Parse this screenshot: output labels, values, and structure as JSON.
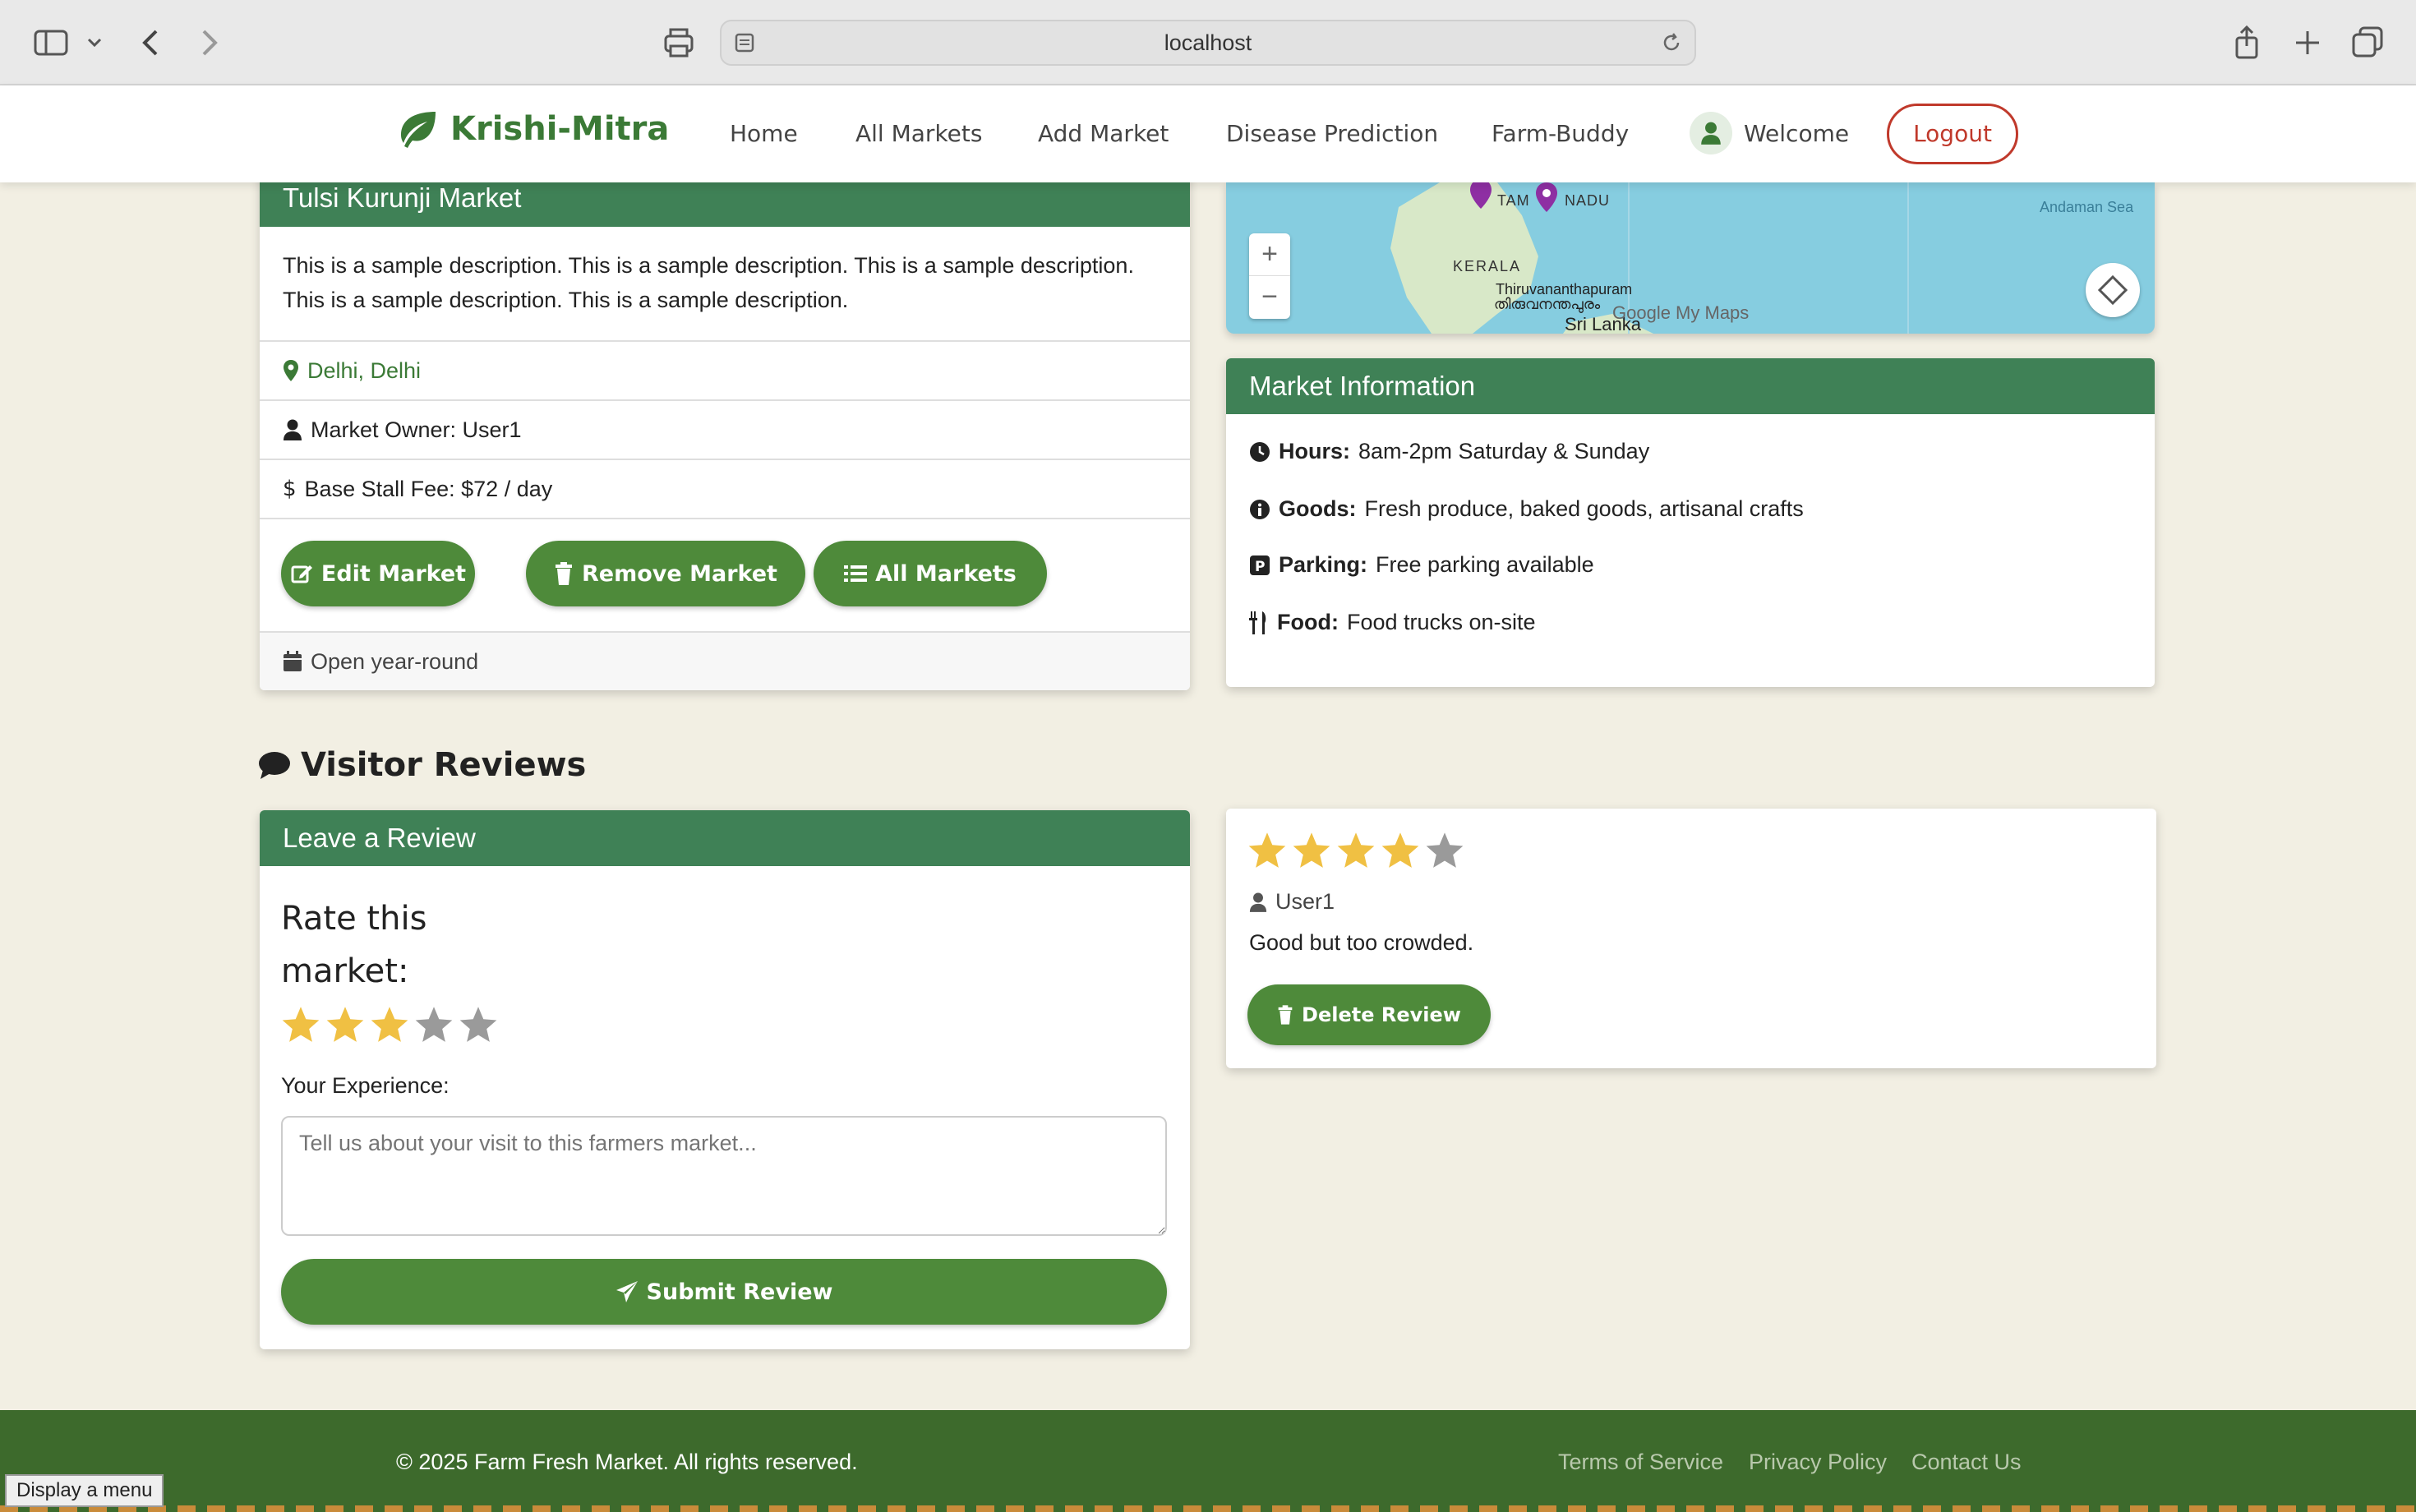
{
  "browser": {
    "url": "localhost"
  },
  "navbar": {
    "brand": "Krishi-Mitra",
    "links": [
      "Home",
      "All Markets",
      "Add Market",
      "Disease Prediction",
      "Farm-Buddy"
    ],
    "welcome": "Welcome",
    "logout": "Logout"
  },
  "market": {
    "name": "Tulsi Kurunji Market",
    "description_line1": "This is a sample description. This is a sample description. This is a sample description.",
    "description_line2": "This is a sample description. This is a sample description.",
    "location": "Delhi, Delhi",
    "owner": "Market Owner: User1",
    "stall_fee": "Base Stall Fee: $72 / day",
    "buttons": {
      "edit": "Edit Market",
      "remove": "Remove Market",
      "all": "All Markets"
    },
    "season": "Open year-round"
  },
  "map": {
    "labels": {
      "state1": "TAM",
      "state1b": "NADU",
      "kerala": "KERALA",
      "city": "Thiruvananthapuram",
      "city_local": "തിരുവനന്തപുരം",
      "country": "Sri Lanka",
      "sea": "Andaman Sea",
      "brand": "Google My Maps"
    },
    "zoom_in": "+",
    "zoom_out": "−"
  },
  "info": {
    "title": "Market Information",
    "hours_label": "Hours:",
    "hours": "8am-2pm Saturday & Sunday",
    "goods_label": "Goods:",
    "goods": "Fresh produce, baked goods, artisanal crafts",
    "parking_label": "Parking:",
    "parking": "Free parking available",
    "food_label": "Food:",
    "food": "Food trucks on-site"
  },
  "reviews": {
    "heading": "Visitor Reviews",
    "form": {
      "title": "Leave a Review",
      "rate_line1": "Rate this",
      "rate_line2": "market:",
      "rating": 3,
      "experience_label": "Your Experience:",
      "placeholder": "Tell us about your visit to this farmers market...",
      "submit": "Submit Review"
    },
    "items": [
      {
        "rating": 4,
        "user": "User1",
        "text": "Good but too crowded.",
        "delete": "Delete Review"
      }
    ]
  },
  "footer": {
    "copyright": "© 2025 Farm Fresh Market. All rights reserved.",
    "links": [
      "Terms of Service",
      "Privacy Policy",
      "Contact Us"
    ]
  },
  "tooltip": "Display a menu",
  "colors": {
    "brand_green": "#3b7a36",
    "header_green": "#3f8156",
    "button_green": "#4e8a3a",
    "star_gold": "#f0c043",
    "star_gray": "#9a9a9a",
    "logout_red": "#c0392b",
    "page_bg": "#f2efe3"
  }
}
